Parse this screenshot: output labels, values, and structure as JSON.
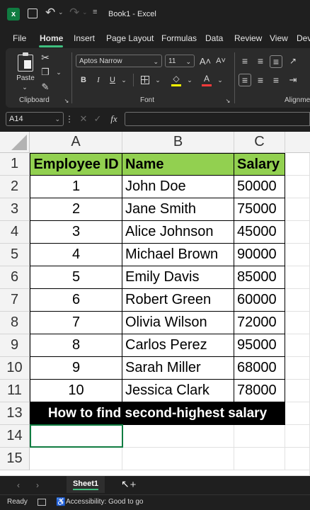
{
  "titlebar": {
    "doc_title": "Book1 - Excel"
  },
  "menu": [
    "File",
    "Home",
    "Insert",
    "Page Layout",
    "Formulas",
    "Data",
    "Review",
    "View",
    "Dev"
  ],
  "ribbon": {
    "paste_label": "Paste",
    "clipboard_label": "Clipboard",
    "font_label": "Font",
    "alignment_label": "Alignme",
    "font_name": "Aptos Narrow",
    "font_size": "11",
    "bold": "B",
    "italic": "I",
    "underline": "U",
    "grow_font": "A˄",
    "shrink_font": "A˅"
  },
  "formula_bar": {
    "name_box": "A14",
    "fx": "fx",
    "value": ""
  },
  "columns": [
    "A",
    "B",
    "C"
  ],
  "rows": [
    "1",
    "2",
    "3",
    "4",
    "5",
    "6",
    "7",
    "8",
    "9",
    "10",
    "11",
    "13",
    "14",
    "15"
  ],
  "table": {
    "headers": [
      "Employee ID",
      "Name",
      "Salary"
    ],
    "records": [
      [
        "1",
        "John Doe",
        "50000"
      ],
      [
        "2",
        "Jane Smith",
        "75000"
      ],
      [
        "3",
        "Alice Johnson",
        "45000"
      ],
      [
        "4",
        "Michael Brown",
        "90000"
      ],
      [
        "5",
        "Emily Davis",
        "85000"
      ],
      [
        "6",
        "Robert Green",
        "60000"
      ],
      [
        "7",
        "Olivia Wilson",
        "72000"
      ],
      [
        "8",
        "Carlos Perez",
        "95000"
      ],
      [
        "9",
        "Sarah Miller",
        "68000"
      ],
      [
        "10",
        "Jessica Clark",
        "78000"
      ]
    ]
  },
  "banner": "How to find second-highest salary",
  "sheet_tabs": [
    "Sheet1"
  ],
  "status": {
    "ready": "Ready",
    "accessibility": "Accessibility: Good to go"
  },
  "colors": {
    "header_green": "#92d050",
    "accent": "#3fbf7f",
    "excel_green": "#107c41"
  }
}
